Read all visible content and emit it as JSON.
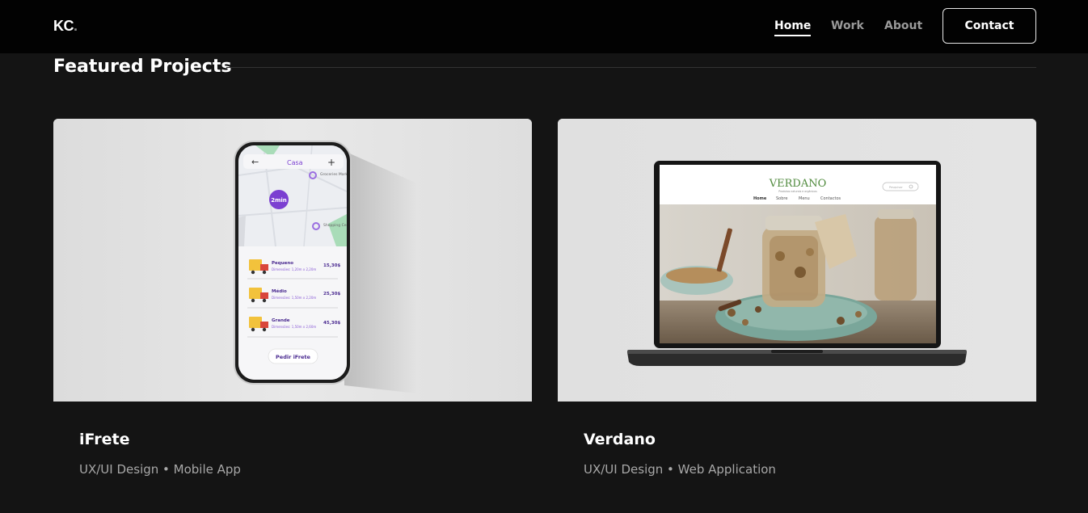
{
  "nav": {
    "logo": "KC",
    "logo_dot": ".",
    "links": [
      {
        "label": "Home",
        "active": true
      },
      {
        "label": "Work",
        "active": false
      },
      {
        "label": "About",
        "active": false
      }
    ],
    "contact_label": "Contact"
  },
  "section": {
    "title": "Featured Projects"
  },
  "projects": [
    {
      "title": "iFrete",
      "subtitle": "UX/UI Design • Mobile App",
      "mockup": {
        "header": "Casa",
        "eta": "2min",
        "places": [
          "Groceries Market",
          "Shopping Center"
        ],
        "options": [
          {
            "name": "Pequeno",
            "dims": "Dimensões: 1,20m x 2,20m",
            "price": "15,30$"
          },
          {
            "name": "Médio",
            "dims": "Dimensões: 1,50m x 2,20m",
            "price": "25,30$"
          },
          {
            "name": "Grande",
            "dims": "Dimensões: 1,50m x 2,60m",
            "price": "45,30$"
          }
        ],
        "cta": "Pedir iFrete"
      }
    },
    {
      "title": "Verdano",
      "subtitle": "UX/UI Design • Web Application",
      "mockup": {
        "brand": "VERDANO",
        "tagline": "Produtos naturais e orgânicos",
        "menu": [
          "Home",
          "Sobre",
          "Menu",
          "Contactos"
        ],
        "search_placeholder": "Pesquisar"
      }
    }
  ],
  "colors": {
    "page_bg": "#141414",
    "navbar_bg": "#020202",
    "card_image_bg": "#e2e2e2",
    "muted_text": "#a8a8a8",
    "accent_purple": "#7b3fd1",
    "map_green": "#a9dcb8",
    "truck_yellow": "#f2c23c",
    "verdano_green": "#4f8a3c"
  }
}
